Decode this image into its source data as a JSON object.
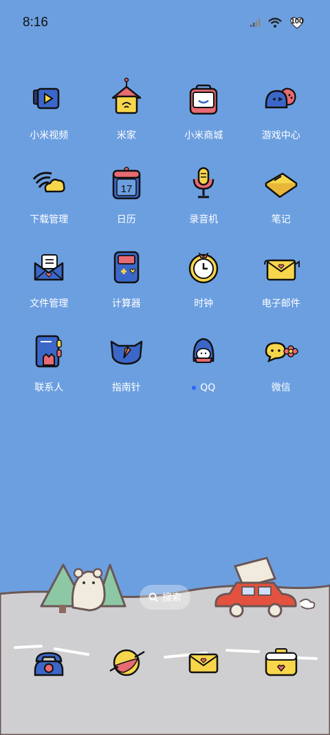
{
  "status": {
    "time": "8:16",
    "battery": "100"
  },
  "apps": [
    {
      "label": "小米视频",
      "icon": "video-icon"
    },
    {
      "label": "米家",
      "icon": "smart-home-icon"
    },
    {
      "label": "小米商城",
      "icon": "shopping-bag-icon"
    },
    {
      "label": "游戏中心",
      "icon": "game-center-icon"
    },
    {
      "label": "下载管理",
      "icon": "download-cloud-icon"
    },
    {
      "label": "日历",
      "icon": "calendar-icon",
      "badge": "17"
    },
    {
      "label": "录音机",
      "icon": "microphone-icon"
    },
    {
      "label": "笔记",
      "icon": "notes-icon"
    },
    {
      "label": "文件管理",
      "icon": "file-envelope-icon"
    },
    {
      "label": "计算器",
      "icon": "calculator-icon"
    },
    {
      "label": "时钟",
      "icon": "clock-icon"
    },
    {
      "label": "电子邮件",
      "icon": "email-icon"
    },
    {
      "label": "联系人",
      "icon": "contacts-icon"
    },
    {
      "label": "指南针",
      "icon": "compass-icon"
    },
    {
      "label": "QQ",
      "icon": "qq-icon"
    },
    {
      "label": "微信",
      "icon": "wechat-icon"
    }
  ],
  "search": {
    "label": "搜索"
  },
  "dock": [
    {
      "icon": "phone-icon"
    },
    {
      "icon": "browser-planet-icon"
    },
    {
      "icon": "messages-icon"
    },
    {
      "icon": "camera-icon"
    }
  ]
}
